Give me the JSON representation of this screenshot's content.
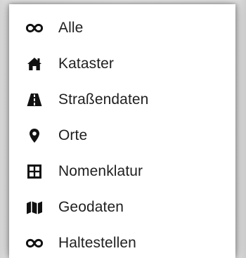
{
  "menu": {
    "items": [
      {
        "label": "Alle",
        "icon": "infinity-icon"
      },
      {
        "label": "Kataster",
        "icon": "home-icon"
      },
      {
        "label": "Straßendaten",
        "icon": "road-icon"
      },
      {
        "label": "Orte",
        "icon": "map-marker-icon"
      },
      {
        "label": "Nomenklatur",
        "icon": "grid-icon"
      },
      {
        "label": "Geodaten",
        "icon": "map-icon"
      },
      {
        "label": "Haltestellen",
        "icon": "infinity-icon"
      }
    ]
  },
  "colors": {
    "icon": "#111111",
    "text": "#1f1f1f",
    "background": "#ffffff"
  }
}
